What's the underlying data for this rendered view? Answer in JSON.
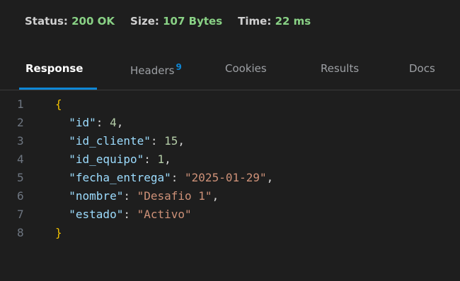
{
  "status": {
    "status_label": "Status:",
    "status_value": "200 OK",
    "size_label": "Size:",
    "size_value": "107 Bytes",
    "time_label": "Time:",
    "time_value": "22 ms"
  },
  "tabs": {
    "response": "Response",
    "headers": "Headers",
    "headers_count": "9",
    "cookies": "Cookies",
    "results": "Results",
    "docs": "Docs",
    "active": "Response"
  },
  "body": {
    "line_numbers": [
      "1",
      "2",
      "3",
      "4",
      "5",
      "6",
      "7",
      "8"
    ],
    "open_brace": "{",
    "close_brace": "}",
    "fields": [
      {
        "key": "\"id\"",
        "value": "4",
        "value_type": "number",
        "trailing": ","
      },
      {
        "key": "\"id_cliente\"",
        "value": "15",
        "value_type": "number",
        "trailing": ","
      },
      {
        "key": "\"id_equipo\"",
        "value": "1",
        "value_type": "number",
        "trailing": ","
      },
      {
        "key": "\"fecha_entrega\"",
        "value": "\"2025-01-29\"",
        "value_type": "string",
        "trailing": ","
      },
      {
        "key": "\"nombre\"",
        "value": "\"Desafio 1\"",
        "value_type": "string",
        "trailing": ","
      },
      {
        "key": "\"estado\"",
        "value": "\"Activo\"",
        "value_type": "string",
        "trailing": ""
      }
    ]
  },
  "colors": {
    "background": "#1e1e1e",
    "status_value": "#89d185",
    "accent": "#0e87d6",
    "json_key": "#9cdcfe",
    "json_string": "#ce9178",
    "json_number": "#b5cea8",
    "brace": "#f0c000"
  }
}
